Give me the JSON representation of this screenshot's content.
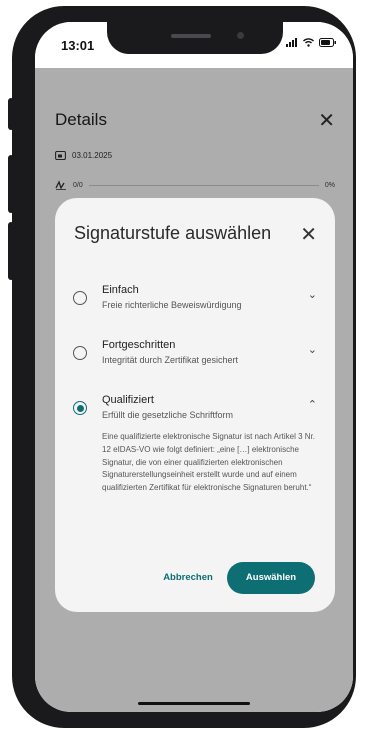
{
  "status_bar": {
    "time": "13:01"
  },
  "background": {
    "title": "Details",
    "date": "03.01.2025",
    "progress_count": "0/0",
    "progress_percent": "0%"
  },
  "dialog": {
    "title": "Signaturstufe auswählen",
    "options": [
      {
        "label": "Einfach",
        "subtitle": "Freie richterliche Beweiswürdigung",
        "selected": false,
        "expanded": false
      },
      {
        "label": "Fortgeschritten",
        "subtitle": "Integrität durch Zertifikat gesichert",
        "selected": false,
        "expanded": false
      },
      {
        "label": "Qualifiziert",
        "subtitle": "Erfüllt die gesetzliche Schriftform",
        "selected": true,
        "expanded": true
      }
    ],
    "description": "Eine qualifizierte elektronische Signatur ist nach Artikel 3 Nr. 12 eIDAS-VO wie folgt definiert: „eine […] elektronische Signatur, die von einer qualifizierten elektronischen Signaturerstellungseinheit erstellt wurde und auf einem qualifizierten Zertifikat für elektronische Signaturen beruht.“",
    "cancel_label": "Abbrechen",
    "select_label": "Auswählen"
  },
  "colors": {
    "accent": "#0d6e73",
    "scrim": "rgba(0,0,0,0.32)"
  }
}
